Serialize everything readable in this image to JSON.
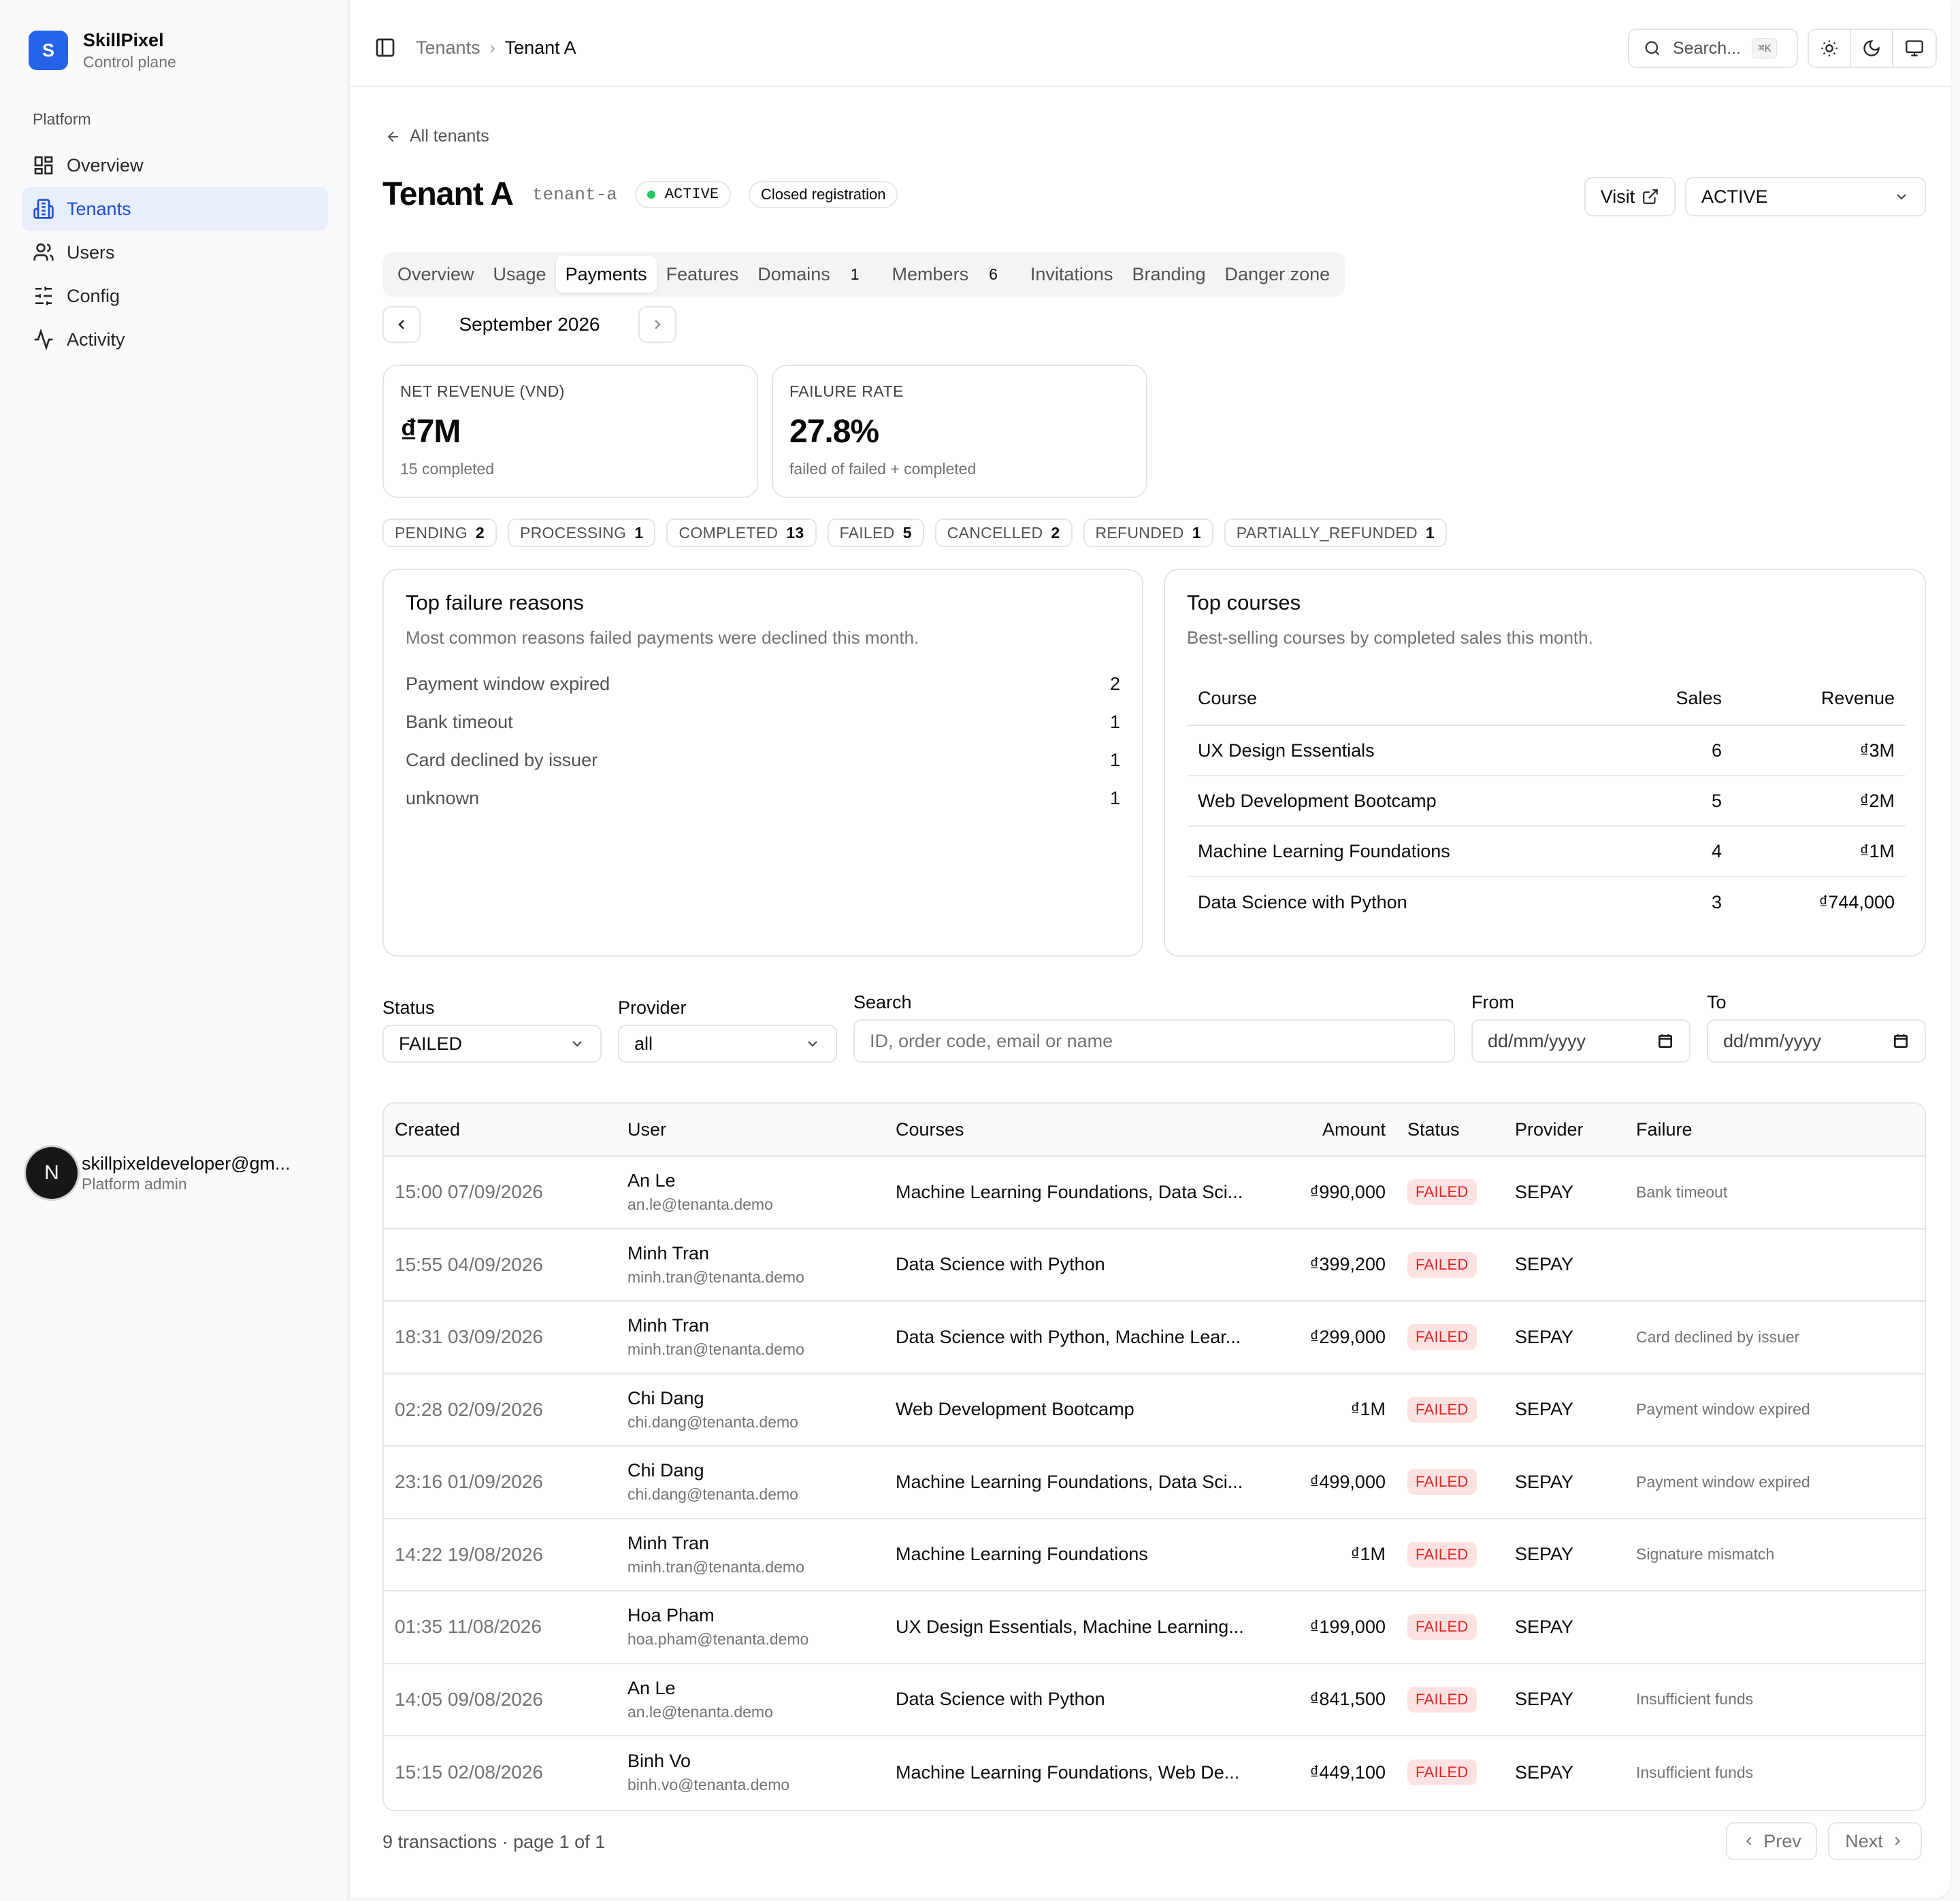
{
  "brand": {
    "logo_letter": "S",
    "name": "SkillPixel",
    "subtitle": "Control plane"
  },
  "sidebar": {
    "group_label": "Platform",
    "items": [
      {
        "label": "Overview",
        "icon": "layout-grid-icon",
        "active": false
      },
      {
        "label": "Tenants",
        "icon": "building-icon",
        "active": true
      },
      {
        "label": "Users",
        "icon": "users-icon",
        "active": false
      },
      {
        "label": "Config",
        "icon": "sliders-icon",
        "active": false
      },
      {
        "label": "Activity",
        "icon": "activity-icon",
        "active": false
      }
    ],
    "user": {
      "initial": "N",
      "email": "skillpixeldeveloper@gm...",
      "role": "Platform admin"
    }
  },
  "topbar": {
    "breadcrumb": [
      "Tenants",
      "Tenant A"
    ],
    "search_label": "Search...",
    "search_shortcut": "⌘K"
  },
  "page": {
    "back_label": "All tenants",
    "title": "Tenant A",
    "slug": "tenant-a",
    "status_badge": "ACTIVE",
    "registration_badge": "Closed registration",
    "visit_label": "Visit",
    "status_select_value": "ACTIVE"
  },
  "tabs": [
    {
      "label": "Overview",
      "count": null,
      "active": false
    },
    {
      "label": "Usage",
      "count": null,
      "active": false
    },
    {
      "label": "Payments",
      "count": null,
      "active": true
    },
    {
      "label": "Features",
      "count": null,
      "active": false
    },
    {
      "label": "Domains",
      "count": "1",
      "active": false
    },
    {
      "label": "Members",
      "count": "6",
      "active": false
    },
    {
      "label": "Invitations",
      "count": null,
      "active": false
    },
    {
      "label": "Branding",
      "count": null,
      "active": false
    },
    {
      "label": "Danger zone",
      "count": null,
      "active": false
    }
  ],
  "month": {
    "label": "September 2026"
  },
  "stats": {
    "revenue": {
      "label": "NET REVENUE (VND)",
      "value": "₫7M",
      "sub": "15 completed"
    },
    "failure": {
      "label": "FAILURE RATE",
      "value": "27.8%",
      "sub": "failed of failed + completed"
    }
  },
  "status_counts": [
    {
      "label": "PENDING",
      "count": "2"
    },
    {
      "label": "PROCESSING",
      "count": "1"
    },
    {
      "label": "COMPLETED",
      "count": "13"
    },
    {
      "label": "FAILED",
      "count": "5"
    },
    {
      "label": "CANCELLED",
      "count": "2"
    },
    {
      "label": "REFUNDED",
      "count": "1"
    },
    {
      "label": "PARTIALLY_REFUNDED",
      "count": "1"
    }
  ],
  "failure_reasons": {
    "title": "Top failure reasons",
    "subtitle": "Most common reasons failed payments were declined this month.",
    "items": [
      {
        "reason": "Payment window expired",
        "count": "2"
      },
      {
        "reason": "Bank timeout",
        "count": "1"
      },
      {
        "reason": "Card declined by issuer",
        "count": "1"
      },
      {
        "reason": "unknown",
        "count": "1"
      }
    ]
  },
  "top_courses": {
    "title": "Top courses",
    "subtitle": "Best-selling courses by completed sales this month.",
    "columns": [
      "Course",
      "Sales",
      "Revenue"
    ],
    "rows": [
      {
        "course": "UX Design Essentials",
        "sales": "6",
        "revenue": "₫3M"
      },
      {
        "course": "Web Development Bootcamp",
        "sales": "5",
        "revenue": "₫2M"
      },
      {
        "course": "Machine Learning Foundations",
        "sales": "4",
        "revenue": "₫1M"
      },
      {
        "course": "Data Science with Python",
        "sales": "3",
        "revenue": "₫744,000"
      }
    ]
  },
  "filters": {
    "status_label": "Status",
    "status_value": "FAILED",
    "provider_label": "Provider",
    "provider_value": "all",
    "search_label": "Search",
    "search_placeholder": "ID, order code, email or name",
    "from_label": "From",
    "from_placeholder": "dd/mm/yyyy",
    "to_label": "To",
    "to_placeholder": "dd/mm/yyyy"
  },
  "transactions": {
    "columns": [
      "Created",
      "User",
      "Courses",
      "Amount",
      "Status",
      "Provider",
      "Failure"
    ],
    "rows": [
      {
        "created": "15:00 07/09/2026",
        "name": "An Le",
        "email": "an.le@tenanta.demo",
        "courses": "Machine Learning Foundations, Data Sci...",
        "amount": "₫990,000",
        "status": "FAILED",
        "provider": "SEPAY",
        "failure": "Bank timeout"
      },
      {
        "created": "15:55 04/09/2026",
        "name": "Minh Tran",
        "email": "minh.tran@tenanta.demo",
        "courses": "Data Science with Python",
        "amount": "₫399,200",
        "status": "FAILED",
        "provider": "SEPAY",
        "failure": ""
      },
      {
        "created": "18:31 03/09/2026",
        "name": "Minh Tran",
        "email": "minh.tran@tenanta.demo",
        "courses": "Data Science with Python, Machine Lear...",
        "amount": "₫299,000",
        "status": "FAILED",
        "provider": "SEPAY",
        "failure": "Card declined by issuer"
      },
      {
        "created": "02:28 02/09/2026",
        "name": "Chi Dang",
        "email": "chi.dang@tenanta.demo",
        "courses": "Web Development Bootcamp",
        "amount": "₫1M",
        "status": "FAILED",
        "provider": "SEPAY",
        "failure": "Payment window expired"
      },
      {
        "created": "23:16 01/09/2026",
        "name": "Chi Dang",
        "email": "chi.dang@tenanta.demo",
        "courses": "Machine Learning Foundations, Data Sci...",
        "amount": "₫499,000",
        "status": "FAILED",
        "provider": "SEPAY",
        "failure": "Payment window expired"
      },
      {
        "created": "14:22 19/08/2026",
        "name": "Minh Tran",
        "email": "minh.tran@tenanta.demo",
        "courses": "Machine Learning Foundations",
        "amount": "₫1M",
        "status": "FAILED",
        "provider": "SEPAY",
        "failure": "Signature mismatch"
      },
      {
        "created": "01:35 11/08/2026",
        "name": "Hoa Pham",
        "email": "hoa.pham@tenanta.demo",
        "courses": "UX Design Essentials, Machine Learning...",
        "amount": "₫199,000",
        "status": "FAILED",
        "provider": "SEPAY",
        "failure": ""
      },
      {
        "created": "14:05 09/08/2026",
        "name": "An Le",
        "email": "an.le@tenanta.demo",
        "courses": "Data Science with Python",
        "amount": "₫841,500",
        "status": "FAILED",
        "provider": "SEPAY",
        "failure": "Insufficient funds"
      },
      {
        "created": "15:15 02/08/2026",
        "name": "Binh Vo",
        "email": "binh.vo@tenanta.demo",
        "courses": "Machine Learning Foundations, Web De...",
        "amount": "₫449,100",
        "status": "FAILED",
        "provider": "SEPAY",
        "failure": "Insufficient funds"
      }
    ],
    "summary": "9 transactions · page 1 of 1",
    "prev_label": "Prev",
    "next_label": "Next"
  },
  "colors": {
    "accent": "#2563eb",
    "active_nav_bg": "#e8eefb",
    "failed_bg": "#fee2e2",
    "failed_text": "#dc2626",
    "active_dot": "#22c55e"
  }
}
